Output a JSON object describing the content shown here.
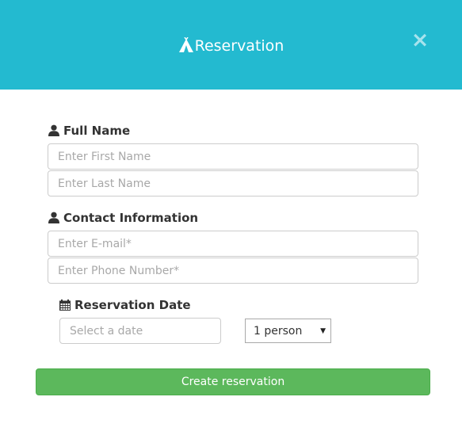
{
  "header": {
    "title": "Reservation",
    "close_label": "×",
    "background": "#23bad0"
  },
  "full_name": {
    "label": "Full Name",
    "first_name_placeholder": "Enter First Name",
    "last_name_placeholder": "Enter Last Name"
  },
  "contact": {
    "label": "Contact Information",
    "email_placeholder": "Enter E-mail*",
    "phone_placeholder": "Enter Phone Number*"
  },
  "reservation_date": {
    "label": "Reservation Date",
    "date_placeholder": "Select a date",
    "party_size_value": "1 person"
  },
  "submit": {
    "label": "Create reservation",
    "color": "#5cb85c"
  },
  "icons": {
    "title": "tent-icon",
    "full_name": "user-icon",
    "contact": "user-icon",
    "date": "calendar-icon",
    "select": "caret-down-icon"
  }
}
